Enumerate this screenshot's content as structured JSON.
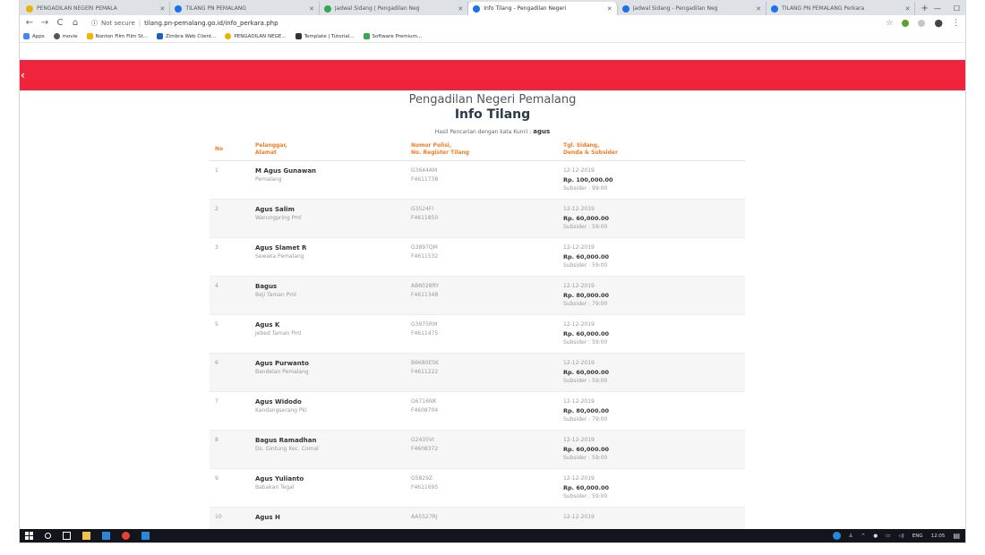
{
  "browser": {
    "tabs": [
      {
        "title": "PENGADILAN NEGERI PEMALA",
        "favicon_color": "#e8b400",
        "active": false
      },
      {
        "title": "TILANG PN PEMALANG",
        "favicon_color": "#1a73e8",
        "active": false
      },
      {
        "title": "Jadwal Sidang | Pengadilan Neg",
        "favicon_color": "#33a852",
        "active": false
      },
      {
        "title": "Info Tilang - Pengadilan Negeri",
        "favicon_color": "#1a73e8",
        "active": true
      },
      {
        "title": "Jadwal Sidang - Pengadilan Neg",
        "favicon_color": "#1a73e8",
        "active": false
      },
      {
        "title": "TILANG PN PEMALANG Perkara",
        "favicon_color": "#1a73e8",
        "active": false
      }
    ],
    "new_tab": "+",
    "address": {
      "security": "Not secure",
      "url": "tilang.pn-pemalang.go.id/info_perkara.php"
    },
    "bookmarks": [
      {
        "label": "Apps",
        "color": "#4285f4"
      },
      {
        "label": "movie",
        "color": "#555555"
      },
      {
        "label": "Nonton Film Film St...",
        "color": "#f4b400"
      },
      {
        "label": "Zimbra Web Client...",
        "color": "#1565c0"
      },
      {
        "label": "PENGADILAN NEGE...",
        "color": "#e8b400"
      },
      {
        "label": "Template | Tutorial...",
        "color": "#333333"
      },
      {
        "label": "Software Premium...",
        "color": "#34a853"
      }
    ]
  },
  "page": {
    "menu_icon": "‹",
    "org": "Pengadilan Negeri Pemalang",
    "title": "Info Tilang",
    "search_prefix": "Hasil Pencarian dengan kata Kunci :",
    "search_keyword": "agus",
    "accent": "#f0243a",
    "header_color": "#f47c20"
  },
  "table": {
    "headers": {
      "no": "No",
      "col1_a": "Pelanggar,",
      "col1_b": "Alamat",
      "col2_a": "Nomor Polisi,",
      "col2_b": "No. Register Tilang",
      "col3_a": "Tgl. Sidang,",
      "col3_b": "Denda & Subsider"
    },
    "rows": [
      {
        "no": "1",
        "name": "M Agus Gunawan",
        "address": "Pemalang",
        "plate": "G3644AM",
        "register": "F4611738",
        "date": "12-12-2019",
        "fine": "Rp. 100,000.00",
        "subsider": "Subsider : 99:00"
      },
      {
        "no": "2",
        "name": "Agus Salim",
        "address": "Warungpring Pml",
        "plate": "G3524FI",
        "register": "F4611850",
        "date": "12-12-2019",
        "fine": "Rp. 60,000.00",
        "subsider": "Subsider : 59:00"
      },
      {
        "no": "3",
        "name": "Agus Slamet R",
        "address": "Sewaka Pemalang",
        "plate": "G3897QM",
        "register": "F4611532",
        "date": "12-12-2019",
        "fine": "Rp. 60,000.00",
        "subsider": "Subsider : 59:00"
      },
      {
        "no": "4",
        "name": "Bagus",
        "address": "Beji Taman Pml",
        "plate": "AB6028RY",
        "register": "F4611348",
        "date": "12-12-2019",
        "fine": "Rp. 80,000.00",
        "subsider": "Subsider : 79:00"
      },
      {
        "no": "5",
        "name": "Agus K",
        "address": "Jebed Taman Pml",
        "plate": "G3975RM",
        "register": "F4611475",
        "date": "12-12-2019",
        "fine": "Rp. 60,000.00",
        "subsider": "Subsider : 59:00"
      },
      {
        "no": "6",
        "name": "Agus Purwanto",
        "address": "Bandelan Pemalang",
        "plate": "B6680ESK",
        "register": "F4611222",
        "date": "12-12-2019",
        "fine": "Rp. 60,000.00",
        "subsider": "Subsider : 59:00"
      },
      {
        "no": "7",
        "name": "Agus Widodo",
        "address": "Kandangserang Pkl",
        "plate": "G6716NK",
        "register": "F4608704",
        "date": "12-12-2019",
        "fine": "Rp. 80,000.00",
        "subsider": "Subsider : 79:00"
      },
      {
        "no": "8",
        "name": "Bagus Ramadhan",
        "address": "Ds. Gintung Kec. Comal",
        "plate": "G2435VI",
        "register": "F4608372",
        "date": "12-12-2019",
        "fine": "Rp. 60,000.00",
        "subsider": "Subsider : 59:00"
      },
      {
        "no": "9",
        "name": "Agus Yulianto",
        "address": "Babakan Tegal",
        "plate": "G5829Z",
        "register": "F4611695",
        "date": "12-12-2019",
        "fine": "Rp. 60,000.00",
        "subsider": "Subsider : 59:00"
      },
      {
        "no": "10",
        "name": "Agus H",
        "address": "",
        "plate": "AA5527RJ",
        "register": "",
        "date": "12-12-2019",
        "fine": "",
        "subsider": ""
      }
    ]
  },
  "taskbar": {
    "lang": "ENG",
    "time": "12:05",
    "apps": [
      {
        "name": "search-icon",
        "color": "#ffffff"
      },
      {
        "name": "task-view-icon",
        "color": "#ffffff"
      },
      {
        "name": "file-explorer-icon",
        "color": "#f2c14e"
      },
      {
        "name": "store-icon",
        "color": "#2b88d8"
      },
      {
        "name": "chrome-icon",
        "color": "#e94235"
      },
      {
        "name": "photos-icon",
        "color": "#2b88d8"
      }
    ]
  }
}
